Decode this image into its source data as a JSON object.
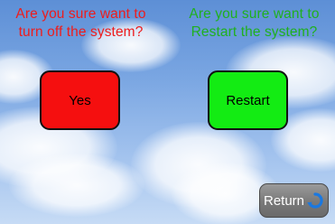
{
  "dialog": {
    "shutdown_prompt_line1": "Are you sure want to",
    "shutdown_prompt_line2": "turn off the system?",
    "restart_prompt_line1": "Are you sure want to",
    "restart_prompt_line2": "Restart the system?"
  },
  "buttons": {
    "yes_label": "Yes",
    "restart_label": "Restart",
    "return_label": "Return",
    "return_icon": "return-arrow-icon"
  },
  "colors": {
    "shutdown_text": "#ee1c1c",
    "restart_text": "#1fb01f",
    "yes_button": "#f50f0f",
    "restart_button": "#13ec13",
    "return_button": "#7c7c7c",
    "return_icon": "#1a78e0"
  }
}
